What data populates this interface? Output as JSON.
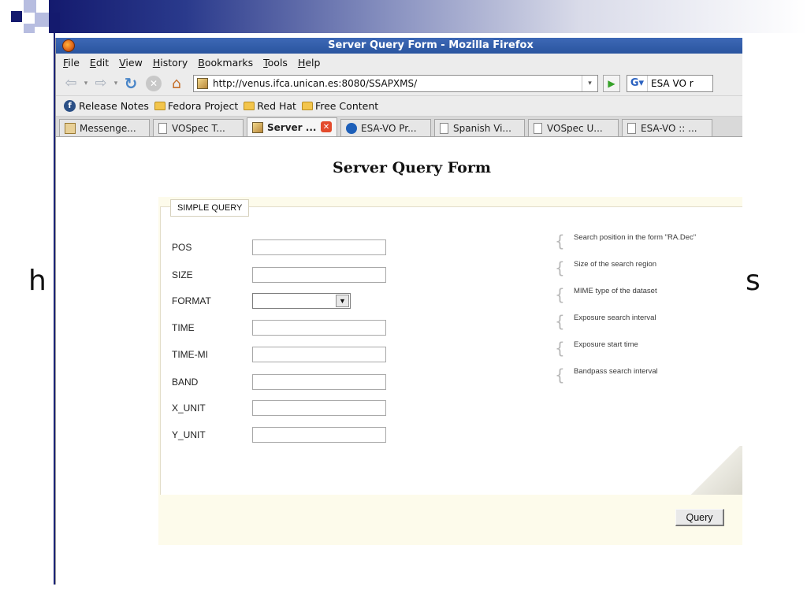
{
  "slide": {
    "left_fragment": "h",
    "right_fragment": "s"
  },
  "window": {
    "title": "Server Query Form - Mozilla Firefox"
  },
  "menu": [
    "File",
    "Edit",
    "View",
    "History",
    "Bookmarks",
    "Tools",
    "Help"
  ],
  "nav": {
    "back_icon": "back-arrow-icon",
    "forward_icon": "forward-arrow-icon",
    "url": "http://venus.ifca.unican.es:8080/SSAPXMS/",
    "search_text": "ESA VO r"
  },
  "bookmarks": [
    "Release Notes",
    "Fedora Project",
    "Red Hat",
    "Free Content"
  ],
  "tabs": [
    {
      "label": "Messenge...",
      "active": false
    },
    {
      "label": "VOSpec T...",
      "active": false
    },
    {
      "label": "Server ...",
      "active": true
    },
    {
      "label": "ESA-VO Pr...",
      "active": false
    },
    {
      "label": "Spanish Vi...",
      "active": false
    },
    {
      "label": "VOSpec U...",
      "active": false
    },
    {
      "label": "ESA-VO :: ...",
      "active": false
    }
  ],
  "page": {
    "title": "Server Query Form",
    "legend": "SIMPLE QUERY",
    "fields": [
      {
        "label": "POS",
        "type": "text",
        "value": ""
      },
      {
        "label": "SIZE",
        "type": "text",
        "value": ""
      },
      {
        "label": "FORMAT",
        "type": "select",
        "value": ""
      },
      {
        "label": "TIME",
        "type": "text",
        "value": ""
      },
      {
        "label": "TIME-MI",
        "type": "text",
        "value": ""
      },
      {
        "label": "BAND",
        "type": "text",
        "value": ""
      },
      {
        "label": "X_UNIT",
        "type": "text",
        "value": ""
      },
      {
        "label": "Y_UNIT",
        "type": "text",
        "value": ""
      }
    ],
    "hints": [
      "Search position in the form \"RA.Dec\"",
      "Size of the search region",
      "MIME type of the dataset",
      "Exposure search interval",
      "Exposure start time",
      "Bandpass search interval"
    ],
    "query_button": "Query"
  },
  "colors": {
    "slide_accent": "#141a6e",
    "titlebar": "#3d68b6",
    "panel_bg": "#fdfbeb"
  }
}
